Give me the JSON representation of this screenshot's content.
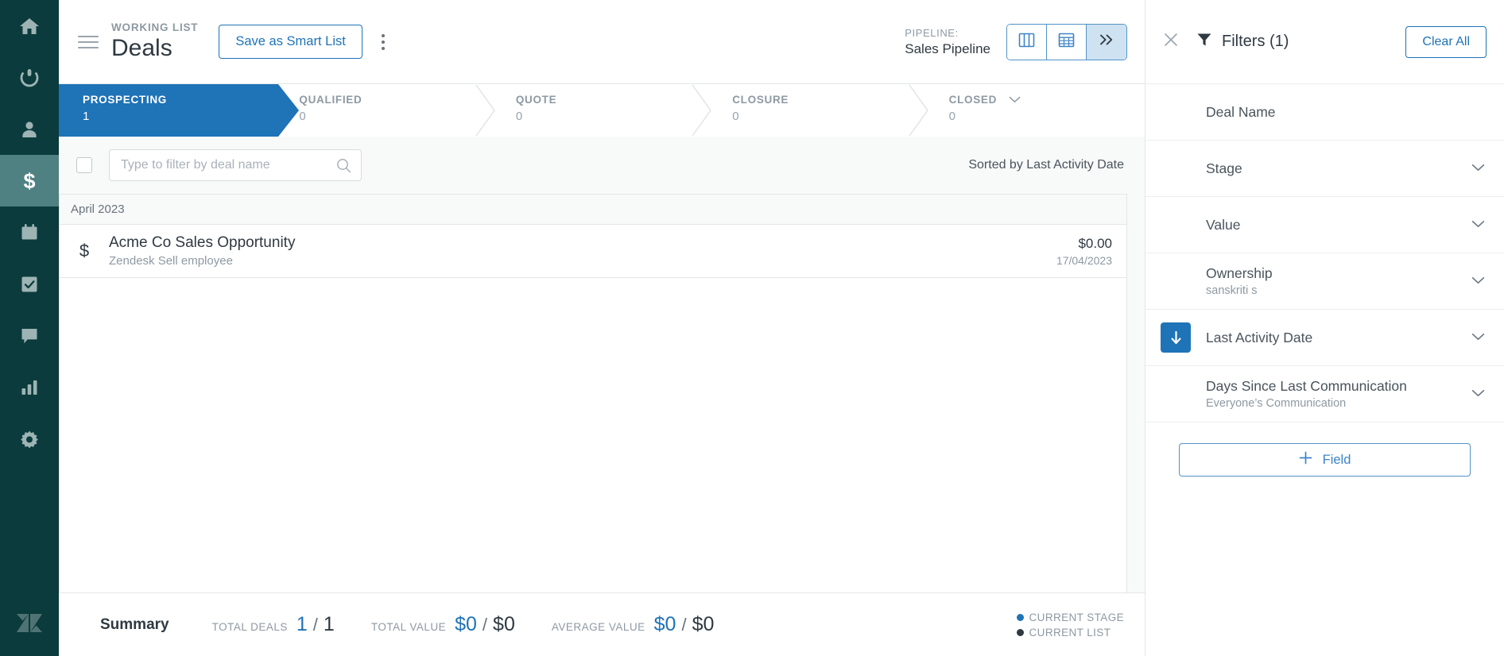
{
  "colors": {
    "nav_bg": "#0b3b3c",
    "nav_active": "#4f8183",
    "accent_blue": "#1f73b7",
    "stage_active": "#1f73b7",
    "text_dark": "#2f3941",
    "text_muted": "#8d99a3",
    "panel_border": "#e4e6e7",
    "legend_current_stage": "#1f73b7",
    "legend_current_list": "#2f3941"
  },
  "sidebar": {
    "items": [
      {
        "icon": "home-icon",
        "name": "home",
        "active": false
      },
      {
        "icon": "prospecting-target-icon",
        "name": "prospecting",
        "active": false
      },
      {
        "icon": "contacts-person-icon",
        "name": "contacts",
        "active": false
      },
      {
        "icon": "deals-dollar-icon",
        "name": "deals",
        "active": true
      },
      {
        "icon": "calendar-icon",
        "name": "calendar",
        "active": false
      },
      {
        "icon": "tasks-check-icon",
        "name": "tasks",
        "active": false
      },
      {
        "icon": "communication-chat-icon",
        "name": "communication",
        "active": false
      },
      {
        "icon": "reports-bar-chart-icon",
        "name": "reports",
        "active": false
      },
      {
        "icon": "settings-gear-icon",
        "name": "settings",
        "active": false
      }
    ],
    "logo": "zendesk-logo-icon"
  },
  "header": {
    "menu_icon": "hamburger-menu-icon",
    "eyebrow": "WORKING LIST",
    "title": "Deals",
    "save_smart_list_label": "Save as Smart List",
    "more_icon": "kebab-menu-icon",
    "pipeline_label": "PIPELINE:",
    "pipeline_value": "Sales Pipeline",
    "views": [
      {
        "name": "kanban-view",
        "icon": "columns-icon",
        "active": false
      },
      {
        "name": "table-view",
        "icon": "grid-table-icon",
        "active": false
      },
      {
        "name": "expanded-view",
        "icon": "double-chevron-right-icon",
        "active": true
      }
    ]
  },
  "stages": [
    {
      "name": "PROSPECTING",
      "count": "1",
      "active": true,
      "has_dropdown": false
    },
    {
      "name": "QUALIFIED",
      "count": "0",
      "active": false,
      "has_dropdown": false
    },
    {
      "name": "QUOTE",
      "count": "0",
      "active": false,
      "has_dropdown": false
    },
    {
      "name": "CLOSURE",
      "count": "0",
      "active": false,
      "has_dropdown": false
    },
    {
      "name": "CLOSED",
      "count": "0",
      "active": false,
      "has_dropdown": true
    }
  ],
  "list": {
    "select_all_checked": false,
    "search_placeholder": "Type to filter by deal name",
    "search_value": "",
    "search_icon": "search-icon",
    "sorted_by": "Sorted by Last Activity Date",
    "group_label": "April 2023",
    "rows": [
      {
        "icon": "deal-dollar-icon",
        "title": "Acme Co Sales Opportunity",
        "subtitle": "Zendesk Sell employee",
        "value": "$0.00",
        "date": "17/04/2023"
      }
    ]
  },
  "summary": {
    "title": "Summary",
    "metrics": [
      {
        "label": "TOTAL DEALS",
        "primary": "1",
        "separator": "/",
        "secondary": "1"
      },
      {
        "label": "TOTAL VALUE",
        "primary": "$0",
        "separator": "/",
        "secondary": "$0"
      },
      {
        "label": "AVERAGE VALUE",
        "primary": "$0",
        "separator": "/",
        "secondary": "$0"
      }
    ],
    "legend": [
      {
        "label": "CURRENT STAGE",
        "color": "#1f73b7"
      },
      {
        "label": "CURRENT LIST",
        "color": "#2f3941"
      }
    ]
  },
  "filters_panel": {
    "close_icon": "close-icon",
    "funnel_icon": "filter-funnel-icon",
    "title": "Filters (1)",
    "clear_all_label": "Clear All",
    "rows": [
      {
        "label": "Deal Name",
        "sub": "",
        "chevron": false,
        "sort_badge": false
      },
      {
        "label": "Stage",
        "sub": "",
        "chevron": true,
        "sort_badge": false
      },
      {
        "label": "Value",
        "sub": "",
        "chevron": true,
        "sort_badge": false
      },
      {
        "label": "Ownership",
        "sub": "sanskriti s",
        "chevron": true,
        "sort_badge": false
      },
      {
        "label": "Last Activity Date",
        "sub": "",
        "chevron": true,
        "sort_badge": true,
        "sort_icon": "sort-descending-arrow-icon"
      },
      {
        "label": "Days Since Last Communication",
        "sub": "Everyone’s Communication",
        "chevron": true,
        "sort_badge": false
      }
    ],
    "add_field_label": "Field",
    "add_field_icon": "plus-icon"
  }
}
